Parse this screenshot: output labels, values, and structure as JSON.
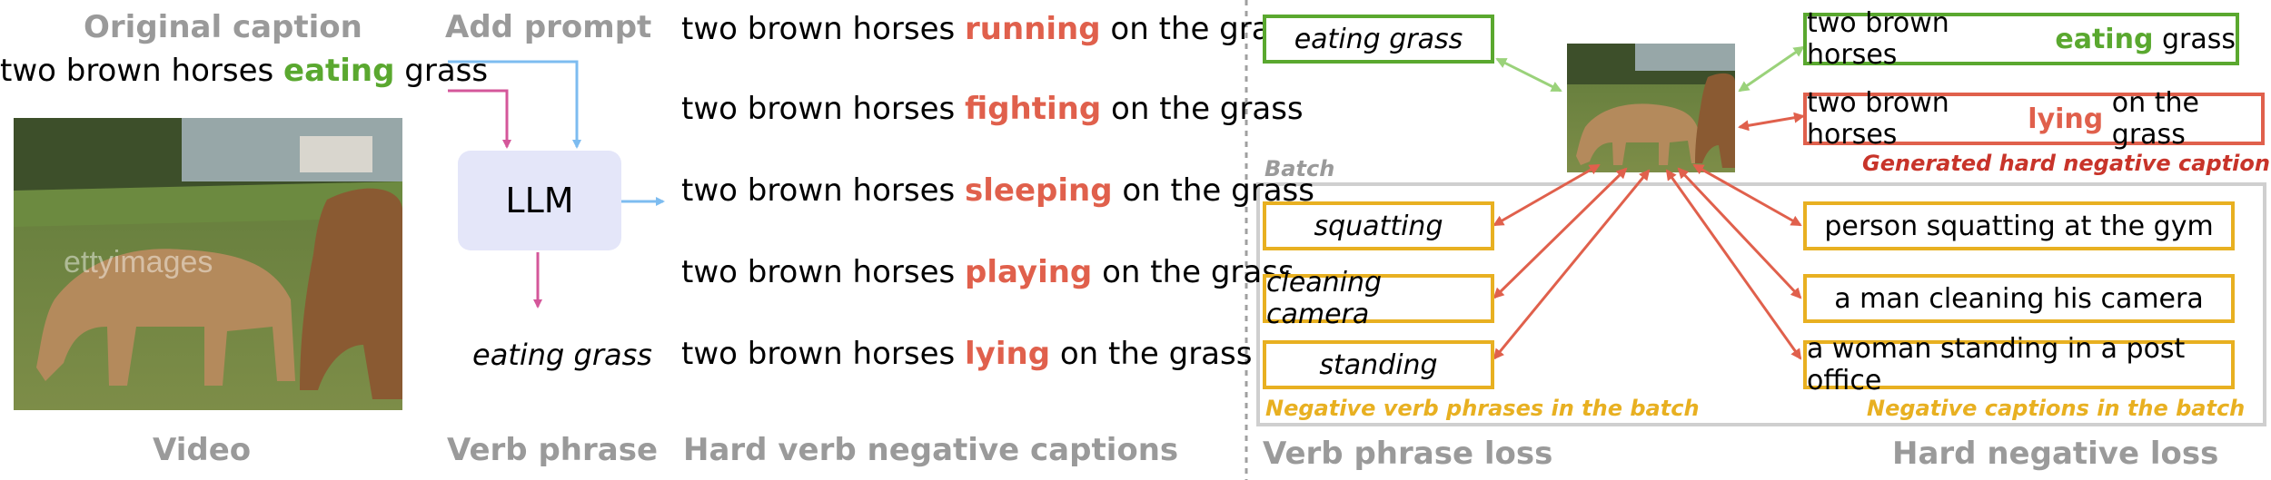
{
  "left": {
    "original_caption_title": "Original caption",
    "original_caption": {
      "pre": "two brown horses",
      "verb": "eating",
      "post": "grass"
    },
    "add_prompt_title": "Add prompt",
    "llm_label": "LLM",
    "verb_phrase_output": "eating grass",
    "negatives": [
      {
        "pre": "two brown horses",
        "verb": "running",
        "post": "on the grass"
      },
      {
        "pre": "two brown horses",
        "verb": "fighting",
        "post": "on the grass"
      },
      {
        "pre": "two brown horses",
        "verb": "sleeping",
        "post": "on the grass"
      },
      {
        "pre": "two brown horses",
        "verb": "playing",
        "post": "on the grass"
      },
      {
        "pre": "two brown horses",
        "verb": "lying",
        "post": "on the grass"
      }
    ],
    "video_watermark": "ettyimages",
    "bottom_titles": {
      "video": "Video",
      "verb_phrase": "Verb phrase",
      "hard_negatives": "Hard verb negative captions"
    }
  },
  "right": {
    "verb_phrase_box": "eating grass",
    "positive_caption": {
      "pre": "two brown horses",
      "verb": "eating",
      "post": "grass"
    },
    "hard_negative_caption": {
      "pre": "two brown horses",
      "verb": "lying",
      "post": "on the grass"
    },
    "hard_negative_note": "Generated hard negative caption",
    "batch_label": "Batch",
    "batch_verb_phrases": [
      "squatting",
      "cleaning camera",
      "standing"
    ],
    "batch_captions": [
      "person squatting at the gym",
      "a man cleaning his camera",
      "a woman standing in a post office"
    ],
    "batch_verb_note": "Negative verb phrases in the batch",
    "batch_caption_note": "Negative captions in the batch",
    "bottom_titles": {
      "verb_phrase_loss": "Verb phrase loss",
      "hard_negative_loss": "Hard negative loss"
    }
  },
  "colors": {
    "green": "#5aa82f",
    "red": "#e0604c",
    "yellow": "#e8b021",
    "blue_arrow": "#7dbcf0",
    "pink_arrow": "#d4579a",
    "llm_fill": "#e4e6f9"
  }
}
